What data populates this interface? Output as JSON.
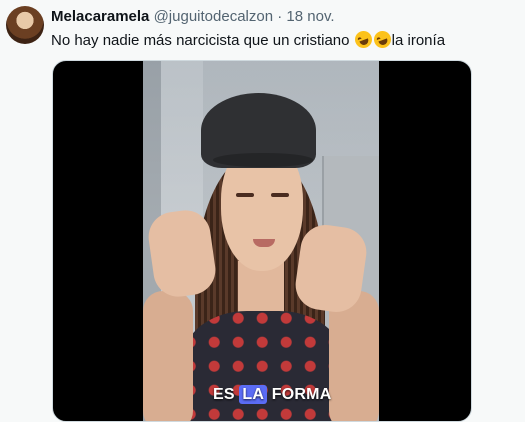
{
  "tweet": {
    "display_name": "Melacaramela",
    "handle": "@juguitodecalzon",
    "separator": "·",
    "date": "18 nov.",
    "text_before": "No hay nadie más narcicista que un cristiano ",
    "text_after": "la ironía",
    "emojis": [
      "rolling-on-floor-laughing-emoji",
      "rolling-on-floor-laughing-emoji"
    ]
  },
  "video": {
    "caption_parts": [
      "ES",
      "LA",
      "FORMA"
    ],
    "caption_highlight": "LA"
  },
  "colors": {
    "background": "#f7f9f9",
    "text": "#0f1419",
    "secondary_text": "#536471",
    "caption_highlight": "#5b6cf5"
  }
}
